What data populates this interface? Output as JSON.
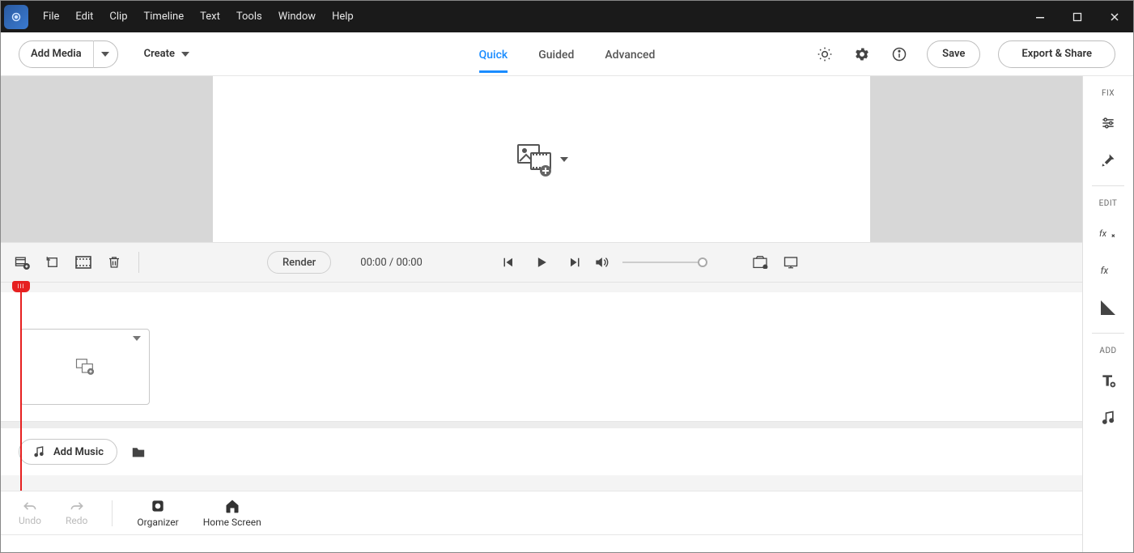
{
  "menu": {
    "file": "File",
    "edit": "Edit",
    "clip": "Clip",
    "timeline": "Timeline",
    "text": "Text",
    "tools": "Tools",
    "window": "Window",
    "help": "Help"
  },
  "toolbar": {
    "add_media": "Add Media",
    "create": "Create",
    "save": "Save",
    "export": "Export & Share"
  },
  "tabs": {
    "quick": "Quick",
    "guided": "Guided",
    "advanced": "Advanced"
  },
  "transport": {
    "render": "Render",
    "current_time": "00:00",
    "separator": " / ",
    "total_time": "00:00"
  },
  "timeline": {
    "add_music": "Add Music"
  },
  "bottombar": {
    "undo": "Undo",
    "redo": "Redo",
    "organizer": "Organizer",
    "home": "Home Screen"
  },
  "right_panel": {
    "fix": "FIX",
    "edit": "EDIT",
    "add": "ADD"
  }
}
